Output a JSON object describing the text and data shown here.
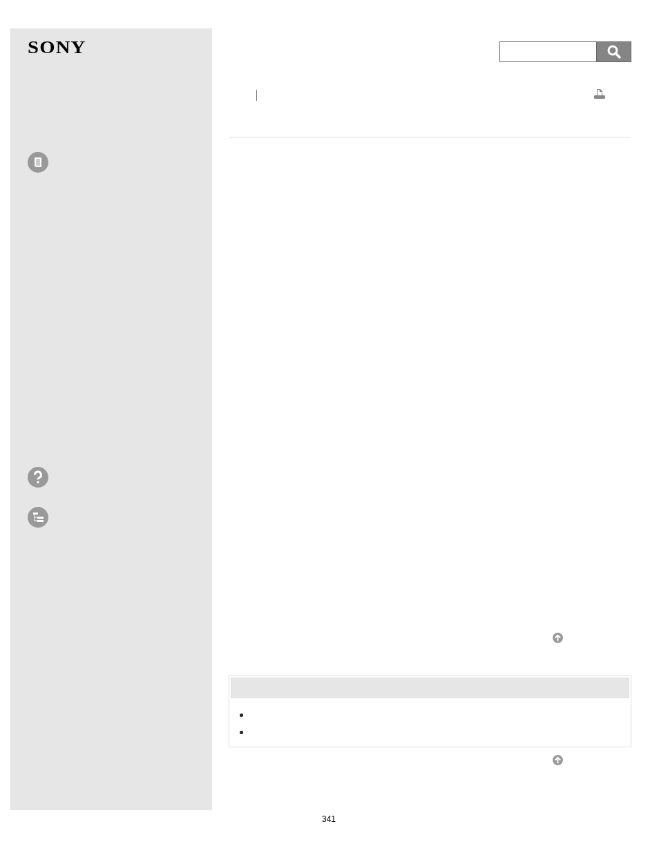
{
  "logo": "SONY",
  "page_number": "341"
}
